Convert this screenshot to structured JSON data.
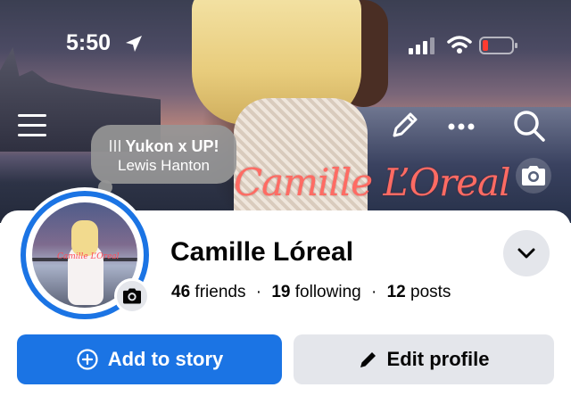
{
  "status_bar": {
    "time": "5:50",
    "location_icon": "location-arrow-icon",
    "signal_icon": "cellular-signal-icon",
    "wifi_icon": "wifi-icon",
    "battery_icon": "battery-low-icon",
    "battery_color": "#ff3b30"
  },
  "cover": {
    "overlay_text": "Camille L’Oreal",
    "overlay_color": "#ff6b63"
  },
  "top_actions": {
    "menu_icon": "hamburger-menu-icon",
    "edit_icon": "pencil-icon",
    "more_icon": "more-dots-icon",
    "search_icon": "search-icon"
  },
  "music": {
    "bars": "III",
    "track": "Yukon x UP!",
    "artist": "Lewis Hanton"
  },
  "profile": {
    "name": "Camille Lóreal",
    "avatar_text": "Camille L’Oreal",
    "friends_count": "46",
    "friends_label": "friends",
    "following_count": "19",
    "following_label": "following",
    "posts_count": "12",
    "posts_label": "posts",
    "separator": "·"
  },
  "actions": {
    "add_story_label": "Add to story",
    "edit_profile_label": "Edit profile"
  },
  "colors": {
    "accent_blue": "#1b74e4",
    "button_gray": "#e4e6eb",
    "text_dark": "#050505"
  }
}
